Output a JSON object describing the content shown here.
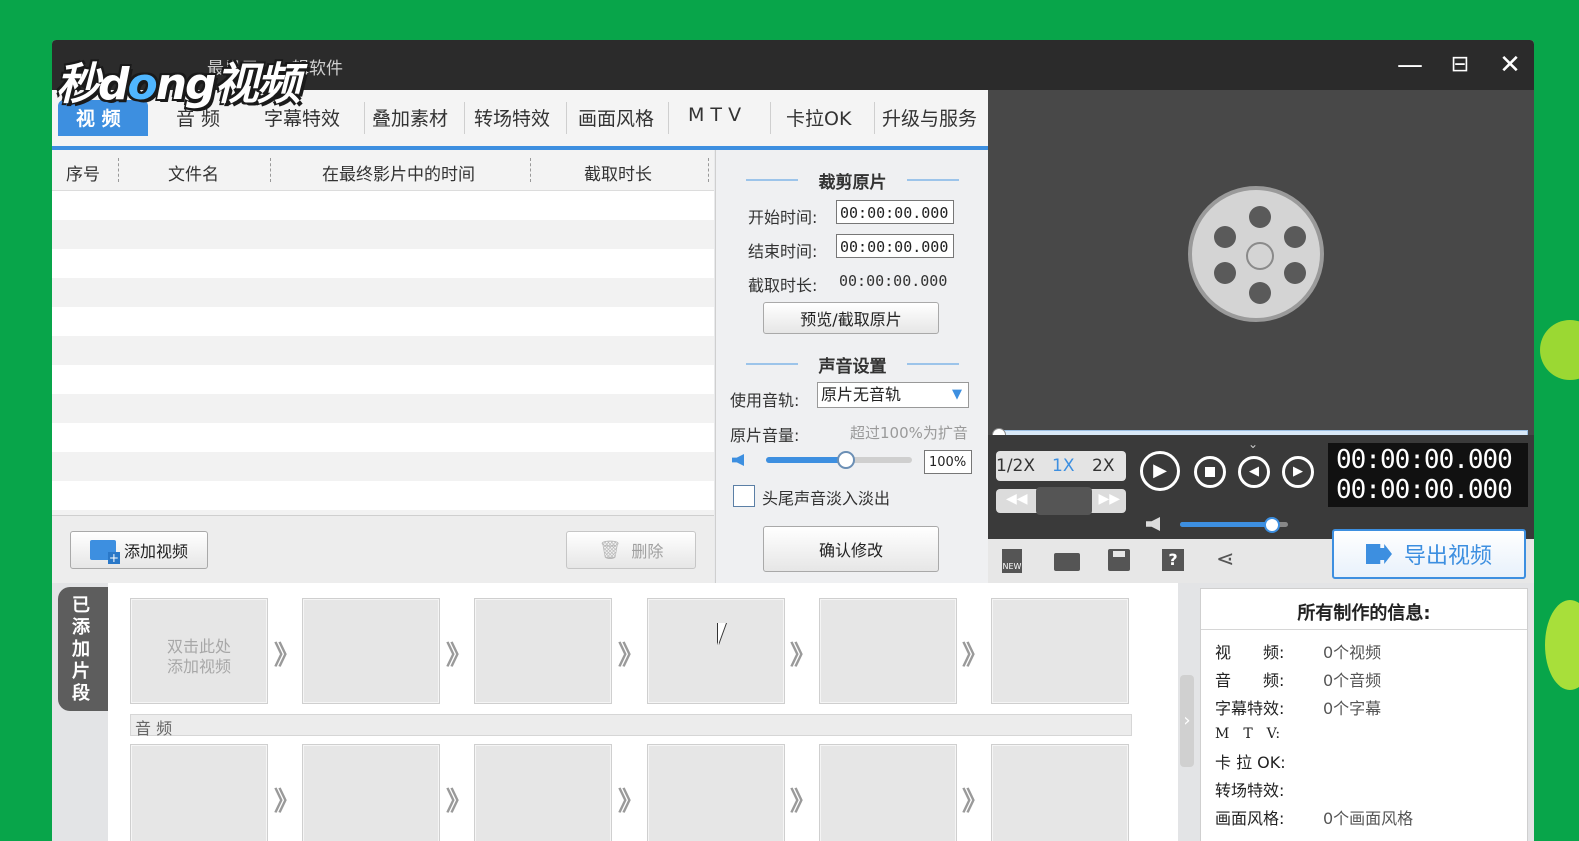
{
  "window": {
    "title": "最易用、…辑软件",
    "watermark_logo": "秒dong视频",
    "controls": [
      "—",
      "⊟",
      "✕"
    ]
  },
  "tabs": [
    "视 频",
    "音 频",
    "字幕特效",
    "叠加素材",
    "转场特效",
    "画面风格",
    "M T V",
    "卡拉OK",
    "升级与服务"
  ],
  "table": {
    "headers": [
      "序号",
      "文件名",
      "在最终影片中的时间",
      "截取时长"
    ]
  },
  "left_footer": {
    "add_video": "添加视频",
    "delete": "删除"
  },
  "trim": {
    "section_title": "裁剪原片",
    "start_label": "开始时间:",
    "start_value": "00:00:00.000",
    "end_label": "结束时间:",
    "end_value": "00:00:00.000",
    "duration_label": "截取时长:",
    "duration_value": "00:00:00.000",
    "preview_button": "预览/截取原片"
  },
  "sound": {
    "section_title": "声音设置",
    "track_label": "使用音轨:",
    "track_value": "原片无音轨",
    "volume_label": "原片音量:",
    "volume_hint": "超过100%为扩音",
    "volume_value": "100%",
    "volume_level": 0.55,
    "fade_label": "头尾声音淡入淡出",
    "confirm_button": "确认修改"
  },
  "player": {
    "speeds": [
      "1/2X",
      "1X",
      "2X"
    ],
    "time_current": "00:00:00.000",
    "time_total": "00:00:00.000",
    "export_button": "导出视频",
    "player_volume": 0.85
  },
  "clips": {
    "side_label": "已添加片段",
    "placeholder_line1": "双击此处",
    "placeholder_line2": "添加视频",
    "audio_label": "音 频"
  },
  "info": {
    "title": "所有制作的信息:",
    "rows": [
      {
        "key": "视　　频:",
        "value": "0个视频"
      },
      {
        "key": "音　　频:",
        "value": "0个音频"
      },
      {
        "key": "字幕特效:",
        "value": "0个字幕"
      },
      {
        "key": "M　T　V:",
        "value": ""
      },
      {
        "key": "卡 拉 OK:",
        "value": ""
      },
      {
        "key": "转场特效:",
        "value": ""
      },
      {
        "key": "画面风格:",
        "value": "0个画面风格"
      }
    ]
  },
  "colors": {
    "background": "#08a54a",
    "accent": "#3d8fe0",
    "titlebar": "#2b2b2b"
  }
}
